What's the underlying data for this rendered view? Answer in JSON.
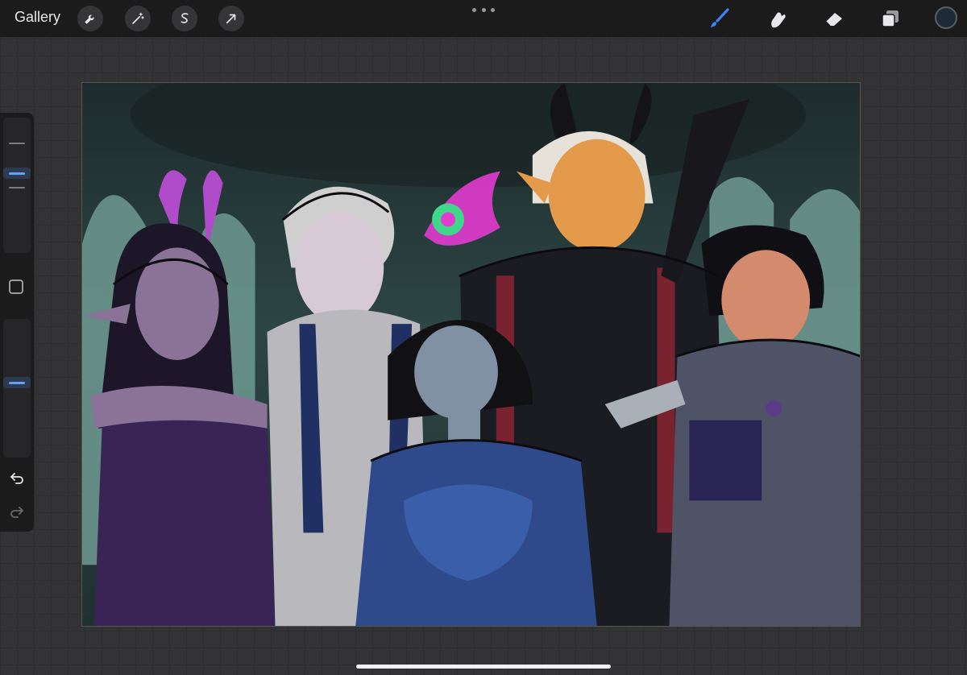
{
  "topbar": {
    "gallery_label": "Gallery",
    "left_tools": [
      "wrench-icon",
      "magic-wand-icon",
      "selection-icon",
      "transform-arrow-icon"
    ],
    "right_tools": [
      "brush-icon",
      "smudge-icon",
      "eraser-icon",
      "layers-icon"
    ],
    "active_tool": "brush-icon",
    "current_color": "#1e2a36",
    "accent_color": "#3b82f6"
  },
  "sidebar": {
    "brush_size_level": 0.56,
    "opacity_level": 0.5,
    "modify_icon": "square-icon",
    "undo_icon": "undo-icon",
    "redo_icon": "redo-icon"
  },
  "canvas": {
    "artwork": "illustration",
    "palette": {
      "background": "#28413f",
      "arches": "#6f9a92",
      "skin_purple": "#8a7396",
      "skin_blue": "#7f91a2",
      "skin_orange": "#e49a4b",
      "cloak_black": "#1b1c22",
      "armor_grey": "#4e5466",
      "dress_blue": "#2e4a8a",
      "magic_pink": "#e23bcf",
      "magic_green": "#3fd88a"
    }
  }
}
